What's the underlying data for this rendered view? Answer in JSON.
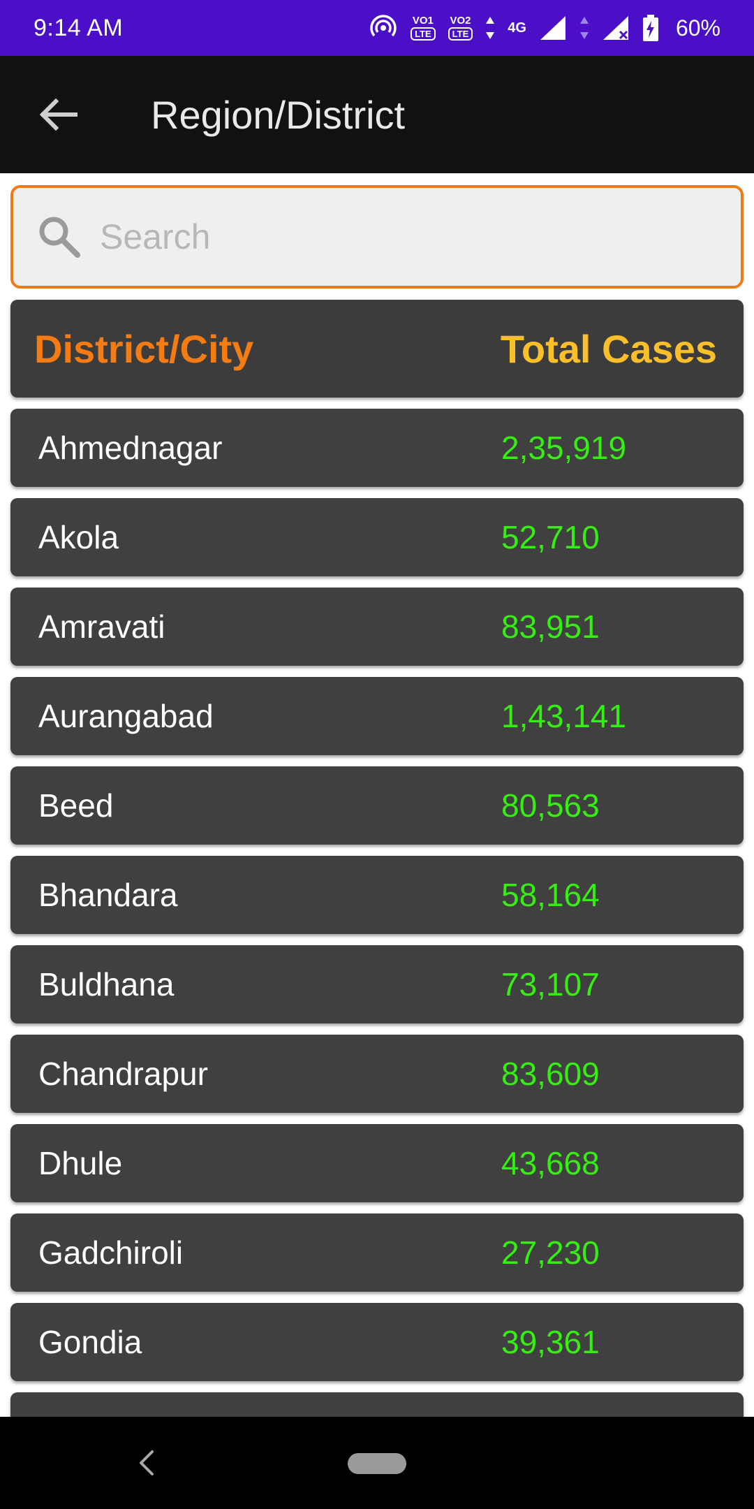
{
  "status_bar": {
    "time": "9:14 AM",
    "sim1_label": "VO",
    "sim1_num": "1",
    "sim2_label": "VO",
    "sim2_num": "2",
    "lte_label": "LTE",
    "network": "4G",
    "battery": "60%",
    "icons": [
      "hotspot-icon",
      "signal-icon",
      "battery-charging-icon"
    ]
  },
  "app_bar": {
    "title": "Region/District",
    "back_icon": "arrow-left-icon"
  },
  "search": {
    "placeholder": "Search",
    "value": "",
    "border_color": "#f07a14"
  },
  "table": {
    "header": {
      "district": "District/City",
      "cases": "Total Cases"
    },
    "rows": [
      {
        "name": "Ahmednagar",
        "cases": "2,35,919"
      },
      {
        "name": "Akola",
        "cases": "52,710"
      },
      {
        "name": "Amravati",
        "cases": "83,951"
      },
      {
        "name": "Aurangabad",
        "cases": "1,43,141"
      },
      {
        "name": "Beed",
        "cases": "80,563"
      },
      {
        "name": "Bhandara",
        "cases": "58,164"
      },
      {
        "name": "Buldhana",
        "cases": "73,107"
      },
      {
        "name": "Chandrapur",
        "cases": "83,609"
      },
      {
        "name": "Dhule",
        "cases": "43,668"
      },
      {
        "name": "Gadchiroli",
        "cases": "27,230"
      },
      {
        "name": "Gondia",
        "cases": "39,361"
      },
      {
        "name": "",
        "cases": ""
      }
    ]
  },
  "colors": {
    "status_bar": "#4a0fc7",
    "app_bar": "#111111",
    "header_district": "#f47c13",
    "header_cases": "#fbbf2c",
    "case_value": "#35ef11",
    "row_bg": "#404040"
  }
}
